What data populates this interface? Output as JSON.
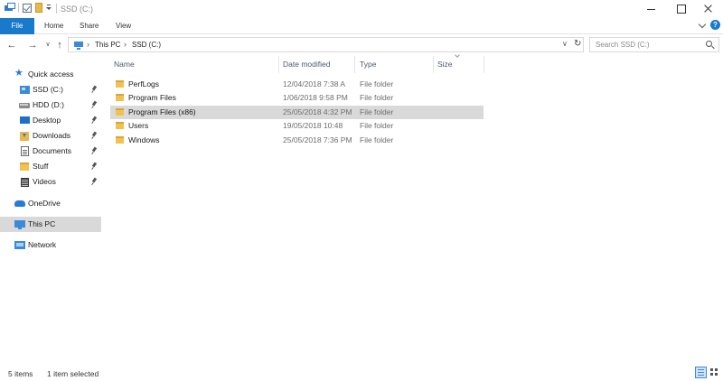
{
  "window": {
    "title": "SSD (C:)"
  },
  "ribbon": {
    "tabs": [
      "File",
      "Home",
      "Share",
      "View"
    ]
  },
  "address": {
    "crumbs": [
      "This PC",
      "SSD (C:)"
    ]
  },
  "search": {
    "placeholder": "Search SSD (C:)"
  },
  "nav": {
    "quick_access": "Quick access",
    "pinned": [
      {
        "label": "SSD (C:)",
        "icon": "ssd-drive-icon"
      },
      {
        "label": "HDD (D:)",
        "icon": "hdd-drive-icon"
      },
      {
        "label": "Desktop",
        "icon": "desktop-icon"
      },
      {
        "label": "Downloads",
        "icon": "downloads-icon"
      },
      {
        "label": "Documents",
        "icon": "documents-icon"
      },
      {
        "label": "Stuff",
        "icon": "folder-icon"
      },
      {
        "label": "Videos",
        "icon": "videos-icon"
      }
    ],
    "onedrive": "OneDrive",
    "this_pc": "This PC",
    "network": "Network"
  },
  "columns": {
    "name": "Name",
    "date_modified": "Date modified",
    "type": "Type",
    "size": "Size"
  },
  "files": [
    {
      "name": "PerfLogs",
      "date": "12/04/2018 7:38 A",
      "type": "File folder",
      "selected": false
    },
    {
      "name": "Program Files",
      "date": "1/06/2018 9:58 PM",
      "type": "File folder",
      "selected": false
    },
    {
      "name": "Program Files (x86)",
      "date": "25/05/2018 4:32 PM",
      "type": "File folder",
      "selected": true
    },
    {
      "name": "Users",
      "date": "19/05/2018 10:48",
      "type": "File folder",
      "selected": false
    },
    {
      "name": "Windows",
      "date": "25/05/2018 7:36 PM",
      "type": "File folder",
      "selected": false
    }
  ],
  "status": {
    "item_count": "5 items",
    "selection": "1 item selected"
  },
  "colors": {
    "accent": "#1979ca",
    "selection": "#d9d9d9",
    "folder": "#f1c250"
  }
}
